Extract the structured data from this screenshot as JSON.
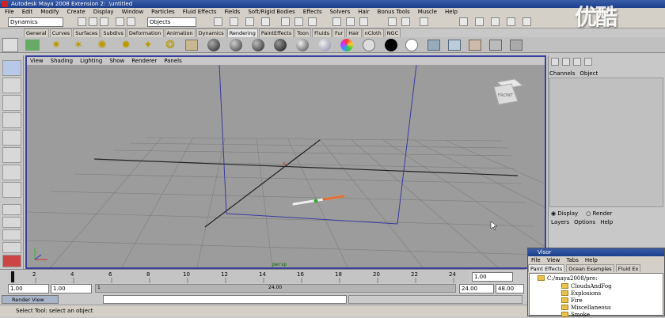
{
  "window": {
    "title": "Autodesk Maya 2008 Extension 2: .\\untitled"
  },
  "menubar": [
    "File",
    "Edit",
    "Modify",
    "Create",
    "Display",
    "Window",
    "Particles",
    "Fluid Effects",
    "Fields",
    "Soft/Rigid Bodies",
    "Effects",
    "Solvers",
    "Hair",
    "Bonus Tools",
    "Muscle",
    "Help"
  ],
  "statusline": {
    "menuset": "Dynamics",
    "selection_mode": "Objects"
  },
  "shelf_tabs": [
    "General",
    "Curves",
    "Surfaces",
    "Subdivs",
    "Deformation",
    "Animation",
    "Dynamics",
    "Rendering",
    "PaintEffects",
    "Toon",
    "Fluids",
    "Fur",
    "Hair",
    "nCloth",
    "NGC"
  ],
  "shelf_active": "Rendering",
  "panel_menu": [
    "View",
    "Shading",
    "Lighting",
    "Show",
    "Renderer",
    "Panels"
  ],
  "viewport": {
    "camera_label": "persp",
    "viewcube_label": "FRONT"
  },
  "channel_box": {
    "menu": [
      "Channels",
      "Object"
    ]
  },
  "layer_editor": {
    "display_label": "Display",
    "render_label": "Render",
    "menu": [
      "Layers",
      "Options",
      "Help"
    ]
  },
  "timeline": {
    "ticks": [
      "2",
      "4",
      "6",
      "8",
      "10",
      "12",
      "14",
      "16",
      "18",
      "20",
      "22",
      "24"
    ],
    "current_frame": "1.00"
  },
  "range": {
    "start": "1.00",
    "inner_start": "1.00",
    "inner_end": "24.00",
    "end": "48.00",
    "marker_start": "1",
    "marker_end": "24.00"
  },
  "command_line": {
    "render_view_label": "Render View"
  },
  "help_line": "Select Tool: select an object",
  "visor": {
    "title": "Visor",
    "menu": [
      "File",
      "View",
      "Tabs",
      "Help"
    ],
    "tabs": [
      "Paint Effects",
      "Ocean Examples",
      "Fluid Ex"
    ],
    "path": "C:/maya2008/pre:",
    "items": [
      "CloudsAndFog",
      "Explosions",
      "Fire",
      "Miscellaneous",
      "Smoke"
    ]
  },
  "watermark": "优酷",
  "colors": {
    "viewport_bg": "#9a9a9a",
    "active_border": "#3b3f9a",
    "titlebar": "#1c3f8c"
  }
}
